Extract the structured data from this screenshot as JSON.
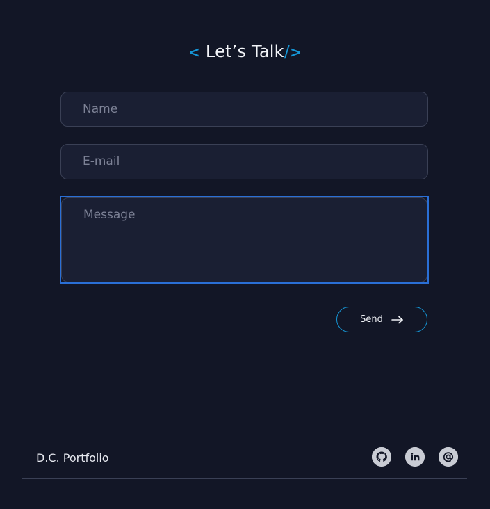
{
  "header": {
    "left_bracket": "<",
    "title": "Let’s Talk",
    "slash": "/",
    "right_bracket": ">"
  },
  "form": {
    "name_placeholder": "Name",
    "email_placeholder": "E-mail",
    "message_placeholder": "Message",
    "send_label": "Send"
  },
  "footer": {
    "brand": "D.C. Portfolio",
    "social_icons": [
      "github-icon",
      "linkedin-icon",
      "email-icon"
    ]
  },
  "colors": {
    "background": "#121626",
    "accent": "#1596d6",
    "field_bg": "#1a1f33",
    "focus_border": "#2a6fd6"
  }
}
